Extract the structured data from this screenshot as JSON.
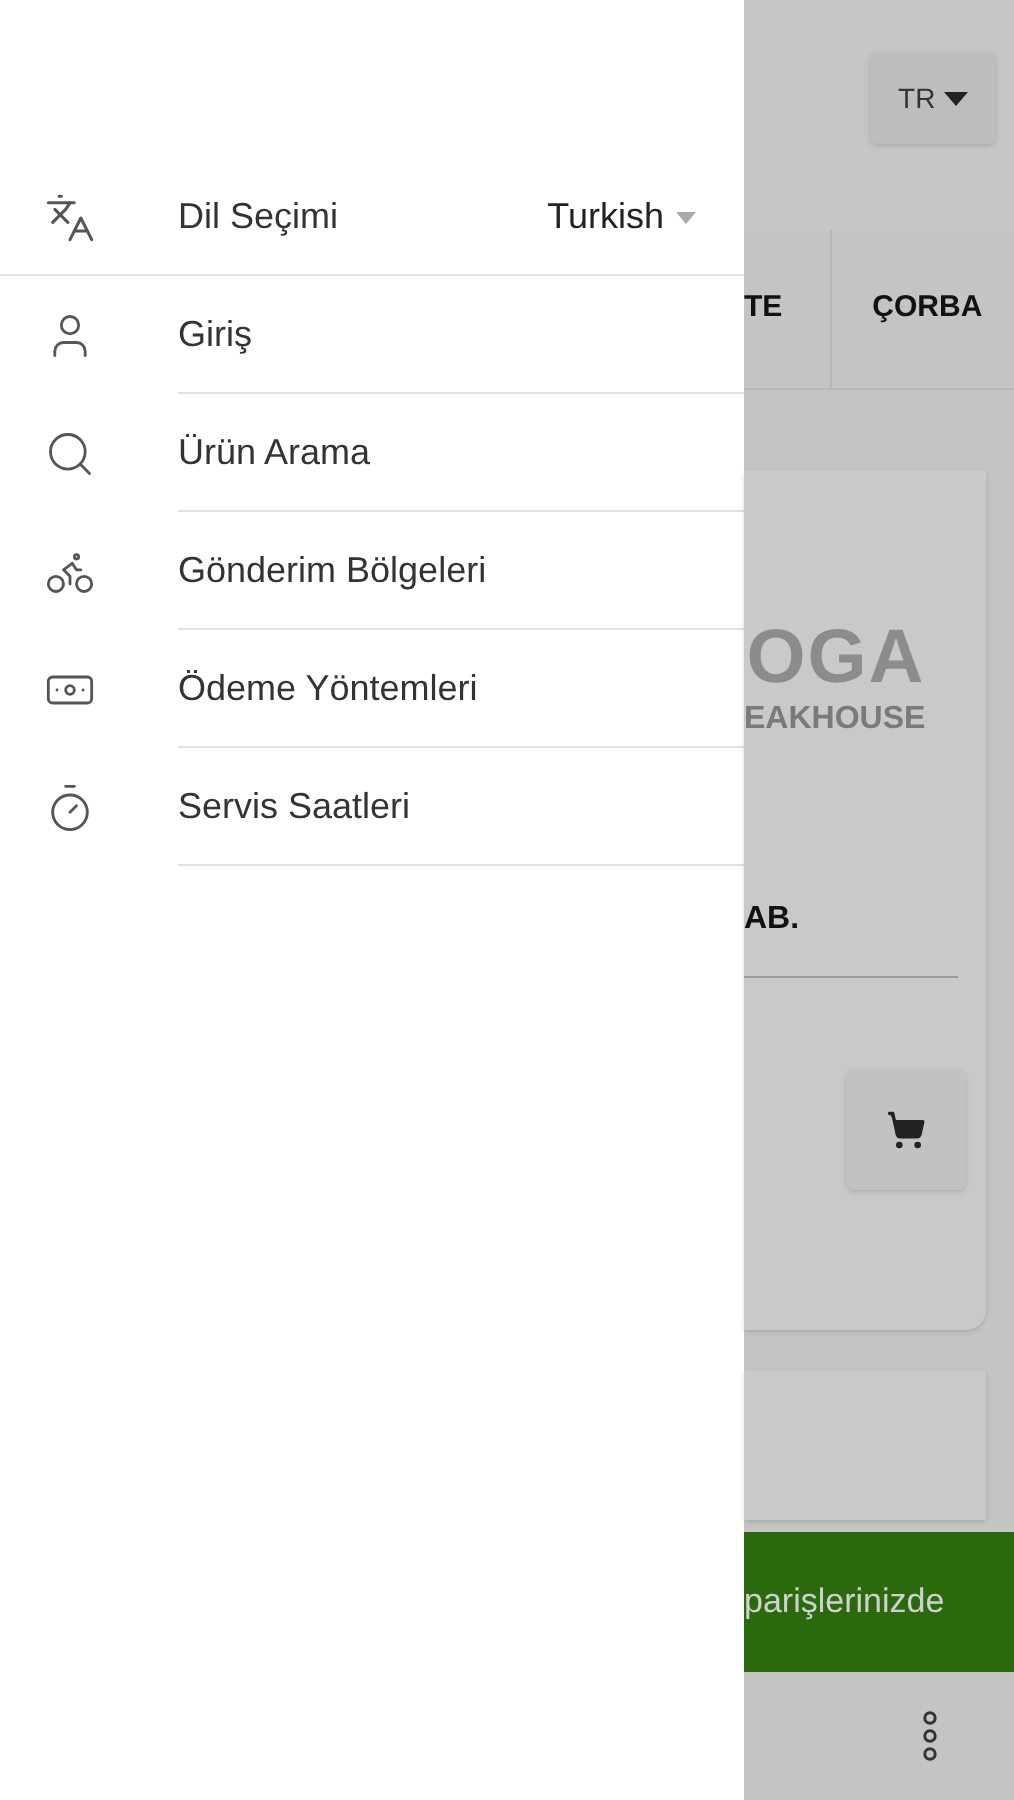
{
  "drawer": {
    "language": {
      "label": "Dil Seçimi",
      "value": "Turkish"
    },
    "menu": [
      {
        "label": "Giriş"
      },
      {
        "label": "Ürün Arama"
      },
      {
        "label": "Gönderim Bölgeleri"
      },
      {
        "label": "Ödeme Yöntemleri"
      },
      {
        "label": "Servis Saatleri"
      }
    ]
  },
  "background": {
    "language_button": "TR",
    "tabs": [
      "TE",
      "ÇORBA"
    ],
    "logo": {
      "line_1": "OGA",
      "line_2": "EAKHOUSE"
    },
    "product_title": "AB.",
    "banner": "parişlerinizde"
  }
}
